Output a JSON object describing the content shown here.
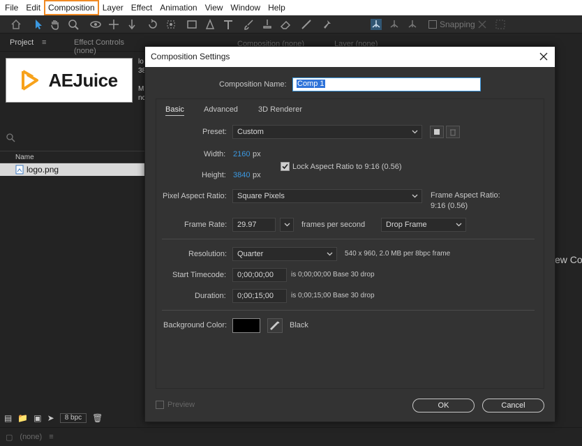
{
  "menu": [
    "File",
    "Edit",
    "Composition",
    "Layer",
    "Effect",
    "Animation",
    "View",
    "Window",
    "Help"
  ],
  "toolbar": {
    "snapping_label": "Snapping"
  },
  "project": {
    "tab_project": "Project",
    "tab_effect_controls": "Effect Controls (none)",
    "logo_text": "AEJuice",
    "meta_line1": "lo",
    "meta_line2": "38",
    "meta_line3": "Mi",
    "meta_line4": "nc",
    "column_name": "Name",
    "file_name": "logo.png",
    "bpc_label": "8 bpc"
  },
  "background": {
    "tab_composition": "Composition (none)",
    "tab_layer": "Layer (none)",
    "new_comp_text": "ew Co",
    "status_none": "(none)"
  },
  "dialog": {
    "title": "Composition Settings",
    "comp_name_label": "Composition Name:",
    "comp_name_value": "Comp 1",
    "tabs": [
      "Basic",
      "Advanced",
      "3D Renderer"
    ],
    "preset_label": "Preset:",
    "preset_value": "Custom",
    "width_label": "Width:",
    "width_value": "2160",
    "height_label": "Height:",
    "height_value": "3840",
    "px_unit": "px",
    "lock_aspect_label": "Lock Aspect Ratio to 9:16 (0.56)",
    "lock_aspect_checked": true,
    "pixel_aspect_label": "Pixel Aspect Ratio:",
    "pixel_aspect_value": "Square Pixels",
    "frame_aspect_label": "Frame Aspect Ratio:",
    "frame_aspect_value": "9:16 (0.56)",
    "frame_rate_label": "Frame Rate:",
    "frame_rate_value": "29.97",
    "fps_unit": "frames per second",
    "drop_frame_value": "Drop Frame",
    "resolution_label": "Resolution:",
    "resolution_value": "Quarter",
    "resolution_info": "540 x 960, 2.0 MB per 8bpc frame",
    "start_tc_label": "Start Timecode:",
    "start_tc_value": "0;00;00;00",
    "start_tc_info": "is 0;00;00;00  Base 30   drop",
    "duration_label": "Duration:",
    "duration_value": "0;00;15;00",
    "duration_info": "is 0;00;15;00  Base 30   drop",
    "bg_color_label": "Background Color:",
    "bg_color_name": "Black",
    "bg_color_hex": "#000000",
    "preview_label": "Preview",
    "ok_label": "OK",
    "cancel_label": "Cancel"
  },
  "colors": {
    "accent": "#3b98e0",
    "menu_highlight": "#f08a24",
    "logo_orange": "#f7a21b"
  }
}
